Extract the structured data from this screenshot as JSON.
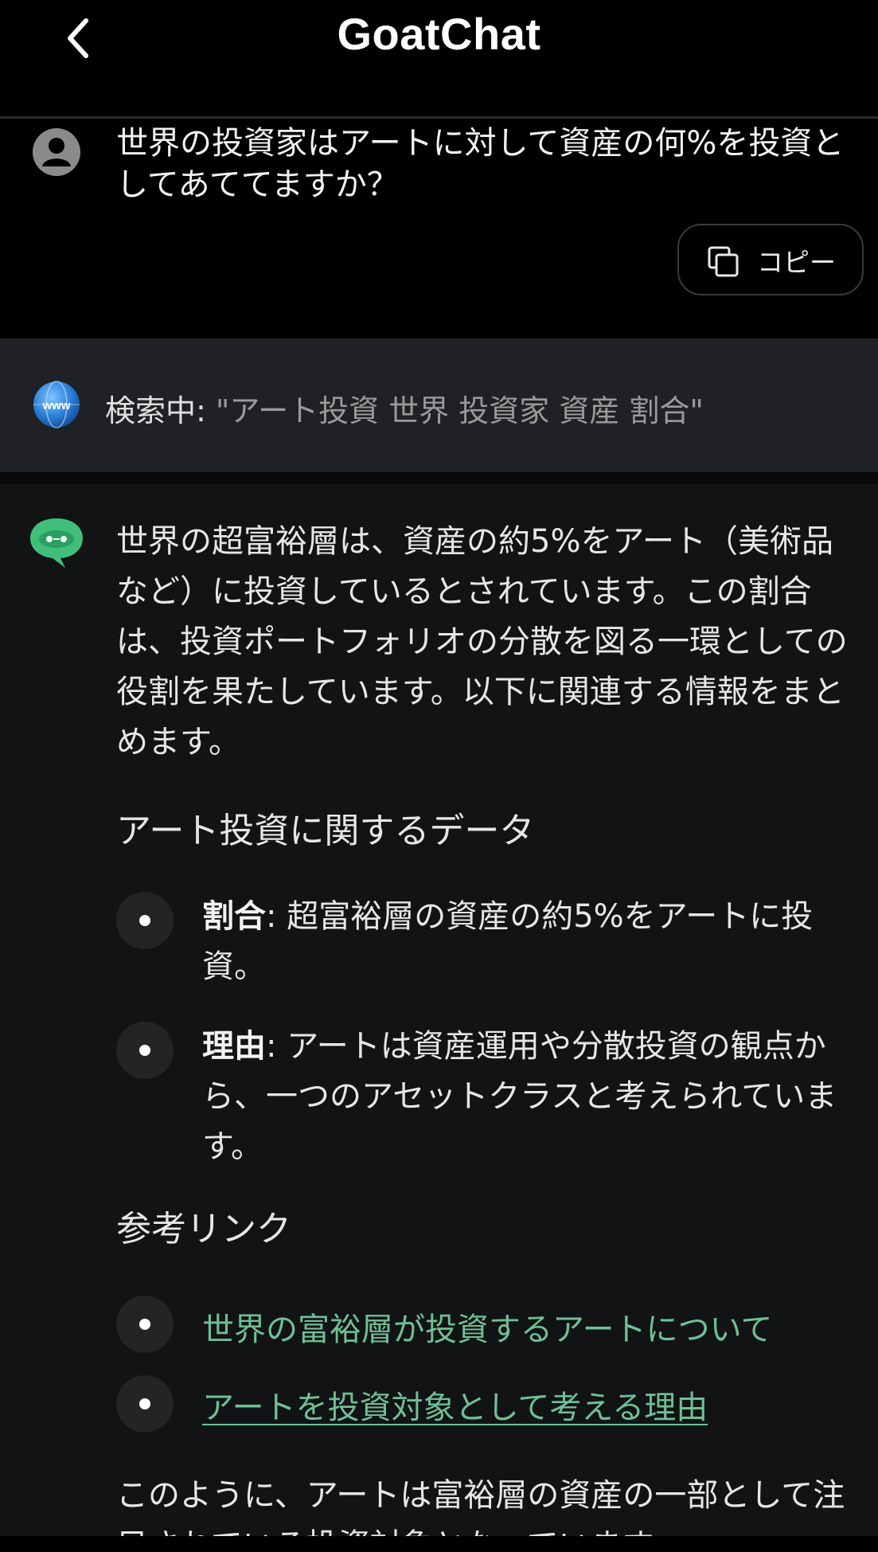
{
  "header": {
    "title": "GoatChat"
  },
  "user_message": {
    "text": "世界の投資家はアートに対して資産の何%を投資としてあててますか？",
    "copy_label": "コピー"
  },
  "search": {
    "prefix": "検索中: ",
    "query": "\"アート投資 世界 投資家 資産 割合\""
  },
  "answer": {
    "intro": "世界の超富裕層は、資産の約5%をアート（美術品など）に投資しているとされています。この割合は、投資ポートフォリオの分散を図る一環としての役割を果たしています。以下に関連する情報をまとめます。",
    "heading1": "アート投資に関するデータ",
    "bullets": [
      {
        "label": "割合",
        "text": ": 超富裕層の資産の約5%をアートに投資。"
      },
      {
        "label": "理由",
        "text": ": アートは資産運用や分散投資の観点から、一つのアセットクラスと考えられています。"
      }
    ],
    "heading2": "参考リンク",
    "links": [
      {
        "text": "世界の富裕層が投資するアートについて"
      },
      {
        "text": "アートを投資対象として考える理由"
      }
    ],
    "closing": "このように、アートは富裕層の資産の一部として注目されている投資対象となっています。"
  },
  "icons": [
    "back-chevron-icon",
    "user-avatar-icon",
    "copy-icon",
    "globe-www-icon",
    "bot-avatar-icon"
  ],
  "colors": {
    "background": "#000000",
    "panel": "#111315",
    "search_panel": "#1f2124",
    "link": "#6fbf95"
  }
}
